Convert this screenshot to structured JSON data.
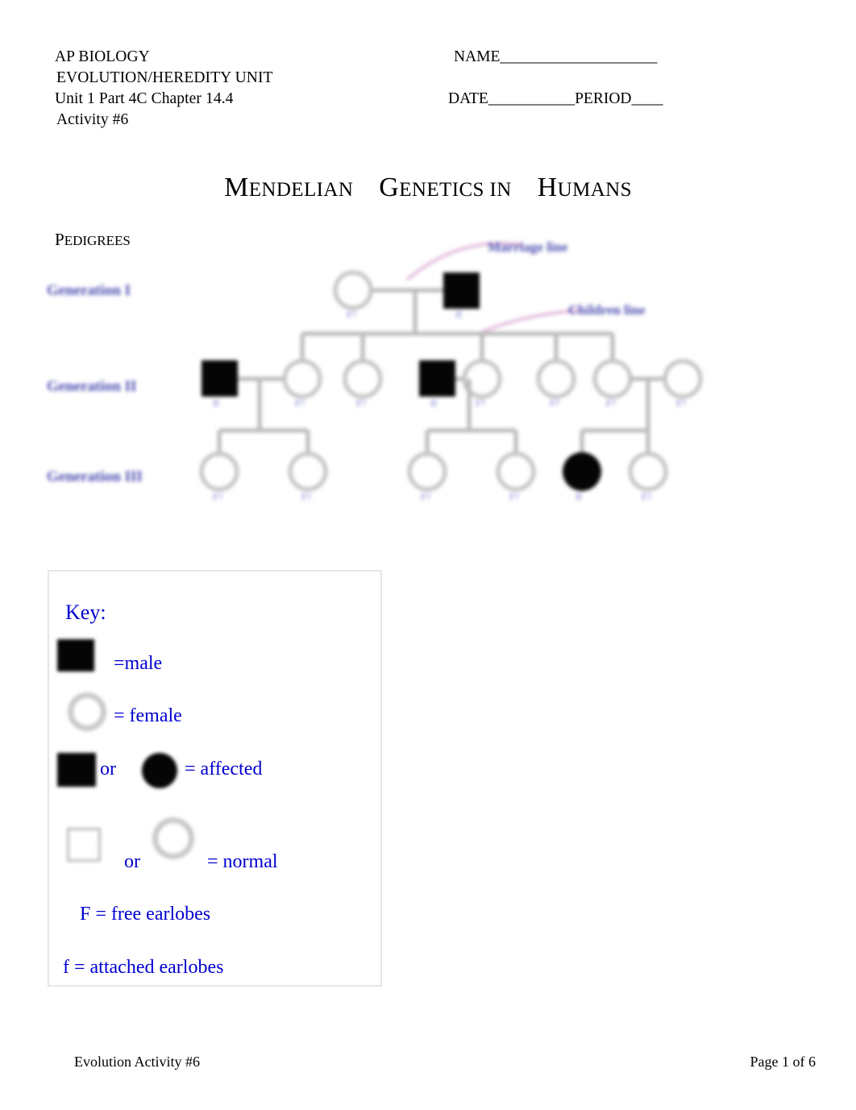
{
  "header": {
    "line1": "AP BIOLOGY",
    "line2": "EVOLUTION/HEREDITY UNIT",
    "line3": "Unit 1 Part 4C Chapter 14.4",
    "line4": "Activity #6",
    "name_field": "NAME____________________",
    "date_field": "DATE___________PERIOD____"
  },
  "title": {
    "word1_cap": "M",
    "word1_rest": "ENDELIAN",
    "word2_cap": "G",
    "word2_rest": "ENETICS IN",
    "word3_cap": "H",
    "word3_rest": "UMANS"
  },
  "section": {
    "pedigrees_cap": "P",
    "pedigrees_rest": "EDIGREES"
  },
  "pedigree": {
    "generation_labels": [
      "Generation I",
      "Generation II",
      "Generation III"
    ],
    "annotations": [
      "Marriage line",
      "Children line"
    ],
    "label_color": "#4a4ab0",
    "annotation_arrow_color": "#e0b8d8",
    "line_color": "#b8b8b8",
    "filled_color": "#050505",
    "generation_1": [
      {
        "shape": "circle",
        "affected": false,
        "label": "F?"
      },
      {
        "shape": "square",
        "affected": true,
        "label": "ff"
      }
    ],
    "generation_2": [
      {
        "shape": "square",
        "affected": true,
        "label": "ff"
      },
      {
        "shape": "circle",
        "affected": false,
        "label": "F?"
      },
      {
        "shape": "circle",
        "affected": false,
        "label": "F?"
      },
      {
        "shape": "square",
        "affected": true,
        "label": "ff"
      },
      {
        "shape": "circle",
        "affected": false,
        "label": "F?"
      },
      {
        "shape": "circle",
        "affected": false,
        "label": "F?"
      },
      {
        "shape": "circle",
        "affected": false,
        "label": "F?"
      }
    ],
    "generation_3": [
      {
        "shape": "circle",
        "affected": false,
        "label": "F?"
      },
      {
        "shape": "circle",
        "affected": false,
        "label": "F?"
      },
      {
        "shape": "circle",
        "affected": false,
        "label": "F?"
      },
      {
        "shape": "circle",
        "affected": false,
        "label": "F?"
      },
      {
        "shape": "circle",
        "affected": true,
        "label": "ff"
      },
      {
        "shape": "circle",
        "affected": false,
        "label": "F?"
      }
    ]
  },
  "key": {
    "title": "Key:",
    "male_label": "=male",
    "female_label": "= female",
    "affected_or": "or",
    "affected_label": "= affected",
    "normal_or": "or",
    "normal_label": "= normal",
    "free_earlobes": "F = free earlobes",
    "attached_earlobes": "f = attached earlobes",
    "text_color": "#0000d0"
  },
  "footer": {
    "left": "Evolution Activity #6",
    "right": "Page 1 of 6"
  }
}
